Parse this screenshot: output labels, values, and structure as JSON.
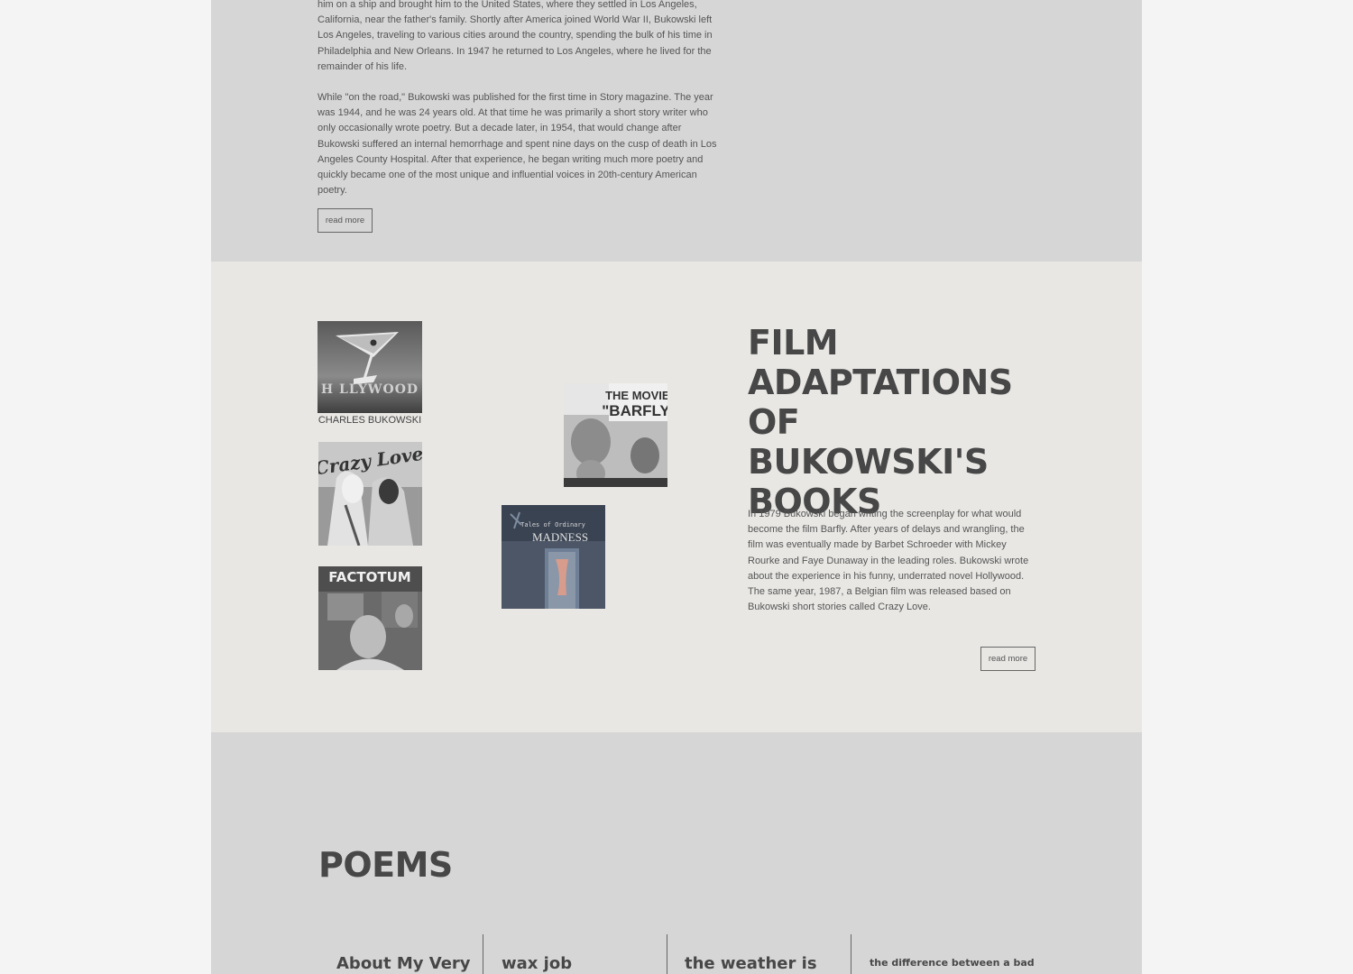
{
  "biography": {
    "paragraph_1": "him on a ship and brought him to the United States, where they settled in Los Angeles, California, near the father's family. Shortly after America joined World War II, Bukowski left Los Angeles, traveling to various cities around the country, spending the bulk of his time in Philadelphia and New Orleans. In 1947 he returned to Los Angeles, where he lived for the remainder of his life.",
    "paragraph_2": "While \"on the road,\" Bukowski was published for the first time in Story magazine. The year was 1944, and he was 24 years old. At that time he was primarily a short story writer who only occasionally wrote poetry. But a decade later, in 1954, that would change after Bukowski suffered an internal hemorrhage and spent nine days on the cusp of death in Los Angeles County Hospital. After that experience, he began writing much more poetry and quickly became one of the most unique and influential voices in 20th-century American poetry.",
    "read_more_label": "read more"
  },
  "film": {
    "title": "FILM ADAPTATIONS OF BUKOWSKI'S BOOKS",
    "text": "In 1979 Bukowski began writing the screenplay for what would become the film Barfly. After years of delays and wrangling, the film was eventually made by Barbet Schroeder with Mickey Rourke and Faye Dunaway in the leading roles. Bukowski wrote about the experience in his funny, underrated novel Hollywood. The same year, 1987, a Belgian film was released based on Bukowski short stories called Crazy Love.",
    "read_more_label": "read more",
    "posters": {
      "hollywood": {
        "title": "H LLYWOOD",
        "author": "CHARLES BUKOWSKI"
      },
      "crazy_love": {
        "title": "Crazy Love"
      },
      "factotum": {
        "title": "FACTOTUM"
      },
      "barfly": {
        "line1": "THE MOVIE:",
        "line2": "\"BARFLY\""
      },
      "madness": {
        "line1": "Tales of Ordinary",
        "line2": "MADNESS"
      }
    }
  },
  "poems": {
    "title": "POEMS",
    "items": [
      {
        "title": "About My Very"
      },
      {
        "title": "wax job"
      },
      {
        "title": "the weather is"
      },
      {
        "title": "the difference between a bad"
      }
    ]
  },
  "colors": {
    "page_background": "#f4f4f4",
    "section_gray": "#d6d6d6",
    "section_light": "#e8e7e4",
    "heading": "#474747",
    "body_text": "#555555"
  }
}
